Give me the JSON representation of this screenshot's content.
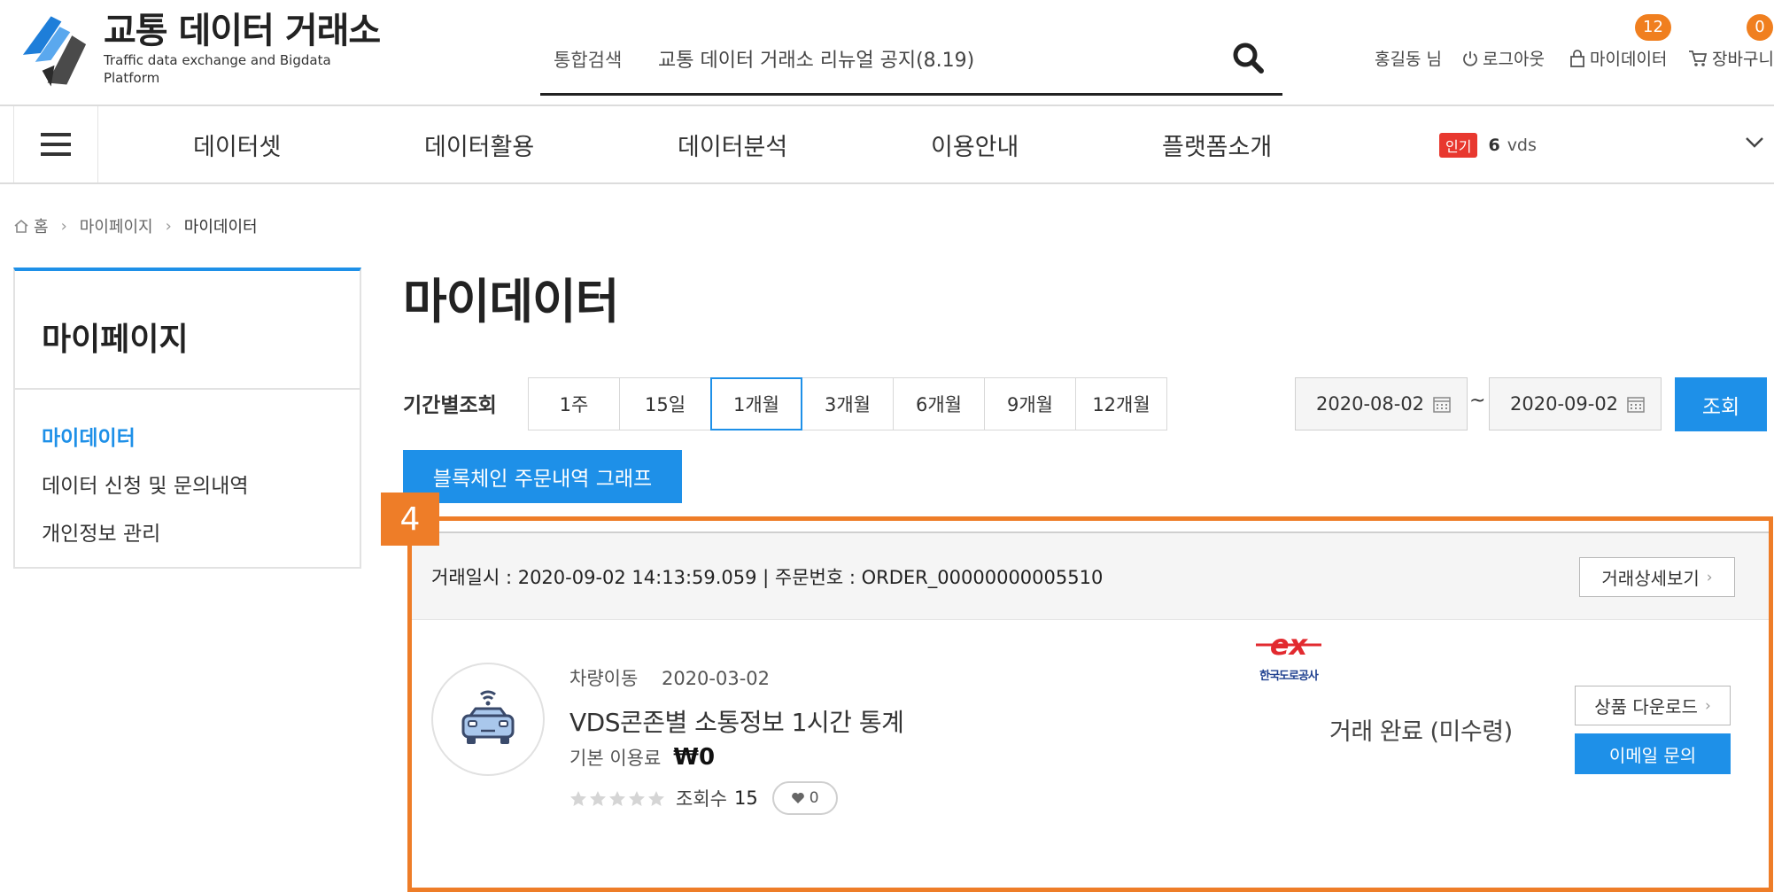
{
  "header": {
    "logo_title": "교통 데이터 거래소",
    "logo_subtitle": "Traffic data exchange and Bigdata Platform",
    "search": {
      "category": "통합검색",
      "value": "교통 데이터 거래소 리뉴얼 공지(8.19)",
      "icon": "search-icon"
    },
    "user_name": "홍길동 님",
    "logout_label": "로그아웃",
    "mydata_label": "마이데이터",
    "mydata_count": "12",
    "cart_label": "장바구니",
    "cart_count": "0"
  },
  "gnb": {
    "items": [
      "데이터셋",
      "데이터활용",
      "데이터분석",
      "이용안내",
      "플랫폼소개"
    ],
    "popular_tag": "인기",
    "popular_rank": "6",
    "popular_keyword": "vds"
  },
  "breadcrumb": [
    "홈",
    "마이페이지",
    "마이데이터"
  ],
  "sidebar": {
    "title": "마이페이지",
    "items": [
      {
        "label": "마이데이터",
        "active": true
      },
      {
        "label": "데이터 신청 및 문의내역",
        "active": false
      },
      {
        "label": "개인정보 관리",
        "active": false
      }
    ]
  },
  "main": {
    "title": "마이데이터",
    "period_label": "기간별조회",
    "period_tabs": [
      "1주",
      "15일",
      "1개월",
      "3개월",
      "6개월",
      "9개월",
      "12개월"
    ],
    "period_selected": "1개월",
    "date_from": "2020-08-02",
    "date_sep": "~",
    "date_to": "2020-09-02",
    "search_label": "조회",
    "blockchain_button": "블록체인 주문내역 그래프"
  },
  "order": {
    "step_badge": "4",
    "info": "거래일시 : 2020-09-02 14:13:59.059 | 주문번호 : ORDER_00000000005510",
    "detail_button": "거래상세보기",
    "product": {
      "category": "차량이동",
      "date": "2020-03-02",
      "name": "VDS콘존별 소통정보 1시간 통계",
      "price_label": "기본 이용료",
      "price": "₩0",
      "rating": 0,
      "views_label": "조회수",
      "views": "15",
      "likes": "0",
      "provider_logo": "ex",
      "provider_name": "한국도로공사"
    },
    "status": "거래 완료 (미수령)",
    "download_button": "상품 다운로드",
    "email_button": "이메일 문의"
  },
  "colors": {
    "accent": "#1e90e8",
    "highlight": "#ee7d28",
    "popular_tag": "#e8382f"
  }
}
